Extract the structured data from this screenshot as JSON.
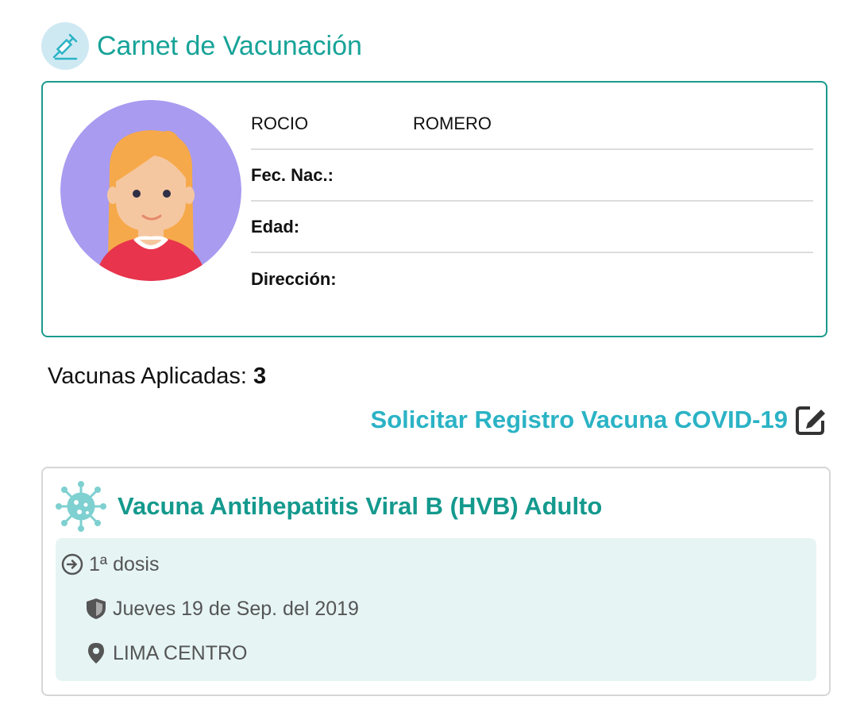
{
  "header": {
    "title": "Carnet de Vacunación",
    "icon": "syringe-icon"
  },
  "profile": {
    "first_name": "ROCIO",
    "last_name": "ROMERO",
    "birth_label": "Fec. Nac.:",
    "age_label": "Edad:",
    "address_label": "Dirección:",
    "avatar": "female-avatar"
  },
  "summary": {
    "applied_label": "Vacunas Aplicadas:",
    "applied_count": "3"
  },
  "covid_link": {
    "label": "Solicitar Registro Vacuna COVID-19",
    "icon": "edit-icon"
  },
  "vaccines": [
    {
      "name": "Vacuna Antihepatitis Viral B (HVB) Adulto",
      "icon": "virus-icon",
      "dose": "1ª dosis",
      "date": "Jueves 19 de Sep. del 2019",
      "location": "LIMA CENTRO"
    }
  ],
  "colors": {
    "teal": "#17a398",
    "link": "#2bb3c5",
    "panel": "#e6f4f4",
    "avatar_bg": "#a89bf0"
  }
}
